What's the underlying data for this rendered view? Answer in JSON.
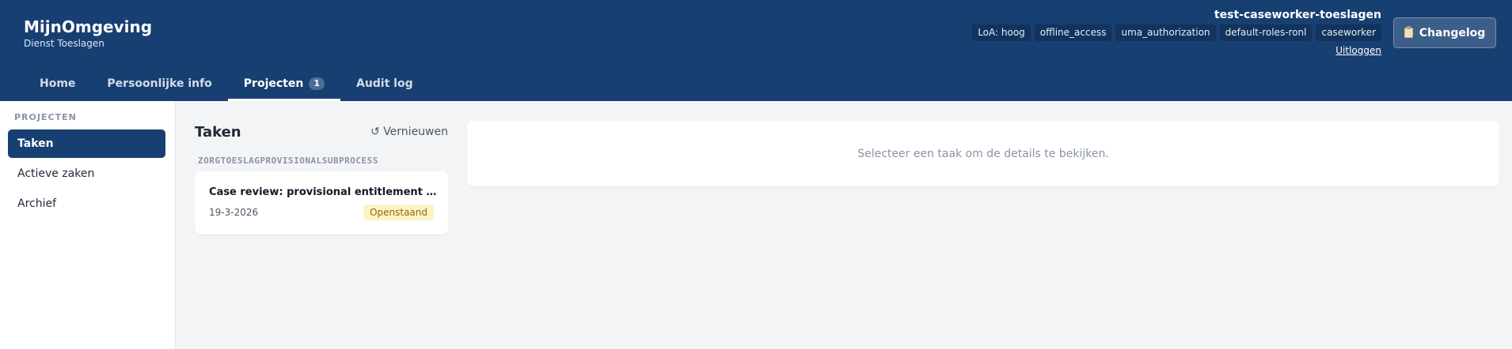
{
  "brand": {
    "title": "MijnOmgeving",
    "subtitle": "Dienst Toeslagen"
  },
  "user": {
    "name": "test-caseworker-toeslagen",
    "roles": [
      "LoA: hoog",
      "offline_access",
      "uma_authorization",
      "default-roles-ronl",
      "caseworker"
    ],
    "logout_label": "Uitloggen"
  },
  "changelog": {
    "label": "Changelog",
    "icon": "clipboard-icon"
  },
  "nav": {
    "tabs": [
      {
        "label": "Home"
      },
      {
        "label": "Persoonlijke info"
      },
      {
        "label": "Projecten",
        "badge": "1",
        "active": true
      },
      {
        "label": "Audit log"
      }
    ]
  },
  "sidebar": {
    "title": "PROJECTEN",
    "items": [
      {
        "label": "Taken",
        "active": true
      },
      {
        "label": "Actieve zaken"
      },
      {
        "label": "Archief"
      }
    ]
  },
  "tasks": {
    "title": "Taken",
    "refresh_label": "↺ Vernieuwen",
    "group_label": "ZORGTOESLAGPROVISIONALSUBPROCESS",
    "items": [
      {
        "name": "Case review: provisional entitlement deci...",
        "date": "19-3-2026",
        "status": "Openstaand"
      }
    ]
  },
  "details": {
    "empty_text": "Selecteer een taak om de details te bekijken."
  },
  "colors": {
    "header": "#173f72",
    "active": "#173f72",
    "status_bg": "#fdf3c4"
  }
}
